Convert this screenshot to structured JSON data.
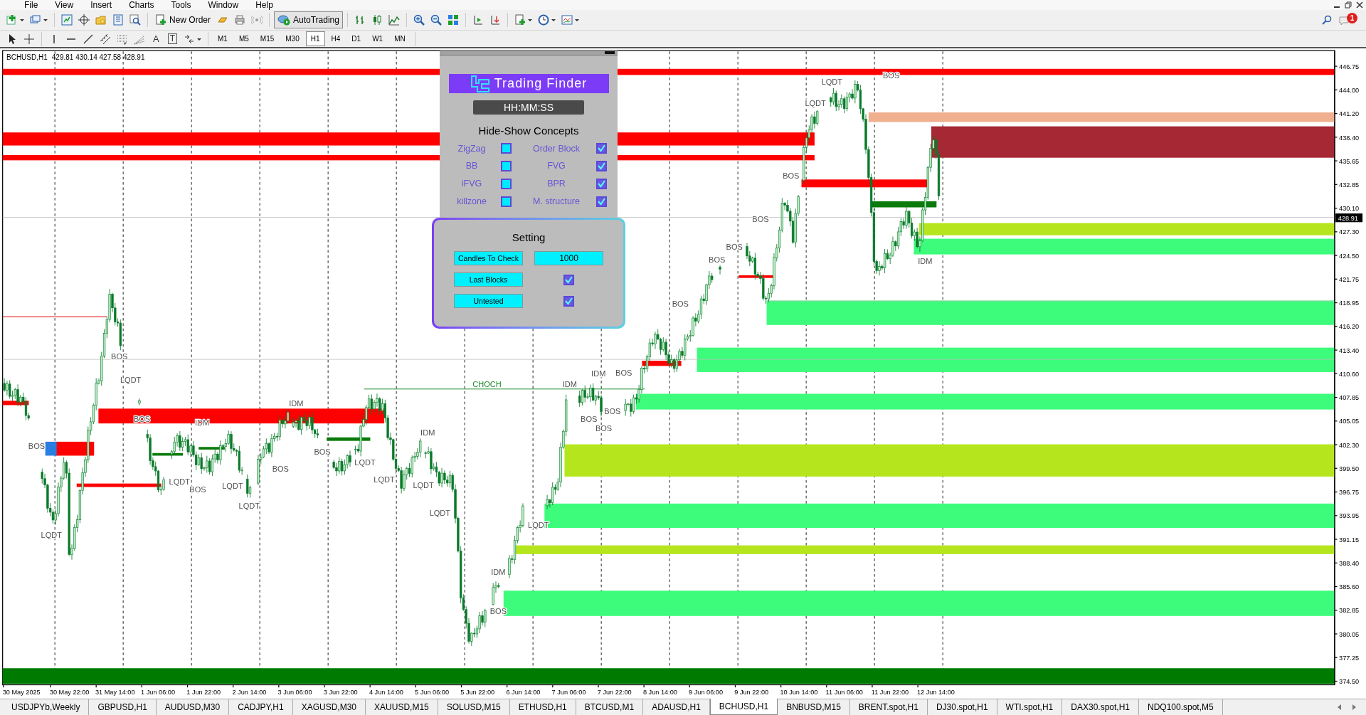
{
  "menu": [
    "File",
    "View",
    "Insert",
    "Charts",
    "Tools",
    "Window",
    "Help"
  ],
  "toolbar": {
    "new_order": "New Order",
    "autotrading": {
      "label": "AutoTrading",
      "on": true
    }
  },
  "drawing_tools": [
    "A",
    "T"
  ],
  "timeframes": [
    {
      "label": "M1",
      "selected": false
    },
    {
      "label": "M5",
      "selected": false
    },
    {
      "label": "M15",
      "selected": false
    },
    {
      "label": "M30",
      "selected": false
    },
    {
      "label": "H1",
      "selected": true
    },
    {
      "label": "H4",
      "selected": false
    },
    {
      "label": "D1",
      "selected": false
    },
    {
      "label": "W1",
      "selected": false
    },
    {
      "label": "MN",
      "selected": false
    }
  ],
  "notifications": {
    "count": "1"
  },
  "chart": {
    "symbol": "BCHUSD,H1",
    "ohlc": "429.81 430.14 427.58 428.91",
    "price_axis": [
      "446.75",
      "444.00",
      "441.20",
      "438.40",
      "435.65",
      "432.85",
      "430.10",
      "427.30",
      "424.50",
      "421.75",
      "418.95",
      "416.20",
      "413.40",
      "410.60",
      "407.85",
      "405.05",
      "402.30",
      "399.50",
      "396.75",
      "393.95",
      "391.15",
      "388.40",
      "385.60",
      "382.85",
      "380.05",
      "377.25",
      "374.50"
    ],
    "current_price": "428.91",
    "time_axis": [
      "30 May 2025",
      "30 May 22:00",
      "31 May 14:00",
      "1 Jun 06:00",
      "1 Jun 22:00",
      "2 Jun 14:00",
      "3 Jun 06:00",
      "3 Jun 22:00",
      "4 Jun 14:00",
      "5 Jun 06:00",
      "5 Jun 22:00",
      "6 Jun 14:00",
      "7 Jun 06:00",
      "7 Jun 22:00",
      "8 Jun 14:00",
      "9 Jun 06:00",
      "9 Jun 22:00",
      "10 Jun 14:00",
      "11 Jun 06:00",
      "11 Jun 22:00",
      "12 Jun 14:00"
    ],
    "choch_label": "CHOCH",
    "labels": [
      "LQDT",
      "BOS",
      "LQDT",
      "BOS",
      "BOS",
      "BOS",
      "BOS",
      "BOS",
      "IDM",
      "IDM",
      "IDM",
      "BOS",
      "BOS",
      "BOS",
      "BOS",
      "IDM",
      "IDM",
      "BOS",
      "IDM",
      "BOS",
      "BOS",
      "LQDT",
      "LQDT",
      "LQDT",
      "BOS",
      "LQDT",
      "LQDT",
      "BOS",
      "BOS",
      "LQDT",
      "LQDT",
      "LQDT",
      "LQDT",
      "IDM",
      "BOS",
      "LQDT"
    ]
  },
  "panel": {
    "logo": "Trading Finder",
    "clock": "HH:MM:SS",
    "concepts_title": "Hide-Show Concepts",
    "concepts": [
      {
        "label": "ZigZag",
        "checked": false
      },
      {
        "label": "Order Block",
        "checked": true
      },
      {
        "label": "BB",
        "checked": false
      },
      {
        "label": "FVG",
        "checked": true
      },
      {
        "label": "iFVG",
        "checked": false
      },
      {
        "label": "BPR",
        "checked": true
      },
      {
        "label": "killzone",
        "checked": false
      },
      {
        "label": "M. structure",
        "checked": true
      }
    ],
    "settings_title": "Setting",
    "settings": [
      {
        "kind": "input",
        "label": "Candles To Check",
        "value": "1000"
      },
      {
        "kind": "checkbox",
        "label": "Last Blocks",
        "checked": true
      },
      {
        "kind": "checkbox",
        "label": "Untested",
        "checked": true
      }
    ]
  },
  "tabs": [
    {
      "label": "USDJPYb,Weekly",
      "selected": false
    },
    {
      "label": "GBPUSD,H1",
      "selected": false
    },
    {
      "label": "AUDUSD,M30",
      "selected": false
    },
    {
      "label": "CADJPY,H1",
      "selected": false
    },
    {
      "label": "XAGUSD,M30",
      "selected": false
    },
    {
      "label": "XAUUSD,M15",
      "selected": false
    },
    {
      "label": "SOLUSD,M15",
      "selected": false
    },
    {
      "label": "ETHUSD,H1",
      "selected": false
    },
    {
      "label": "BTCUSD,M1",
      "selected": false
    },
    {
      "label": "ADAUSD,H1",
      "selected": false
    },
    {
      "label": "BCHUSD,H1",
      "selected": true
    },
    {
      "label": "BNBUSD,M15",
      "selected": false
    },
    {
      "label": "BRENT.spot,H1",
      "selected": false
    },
    {
      "label": "DJ30.spot,H1",
      "selected": false
    },
    {
      "label": "WTI.spot,H1",
      "selected": false
    },
    {
      "label": "DAX30.spot,H1",
      "selected": false
    },
    {
      "label": "NDQ100.spot,M5",
      "selected": false
    }
  ]
}
